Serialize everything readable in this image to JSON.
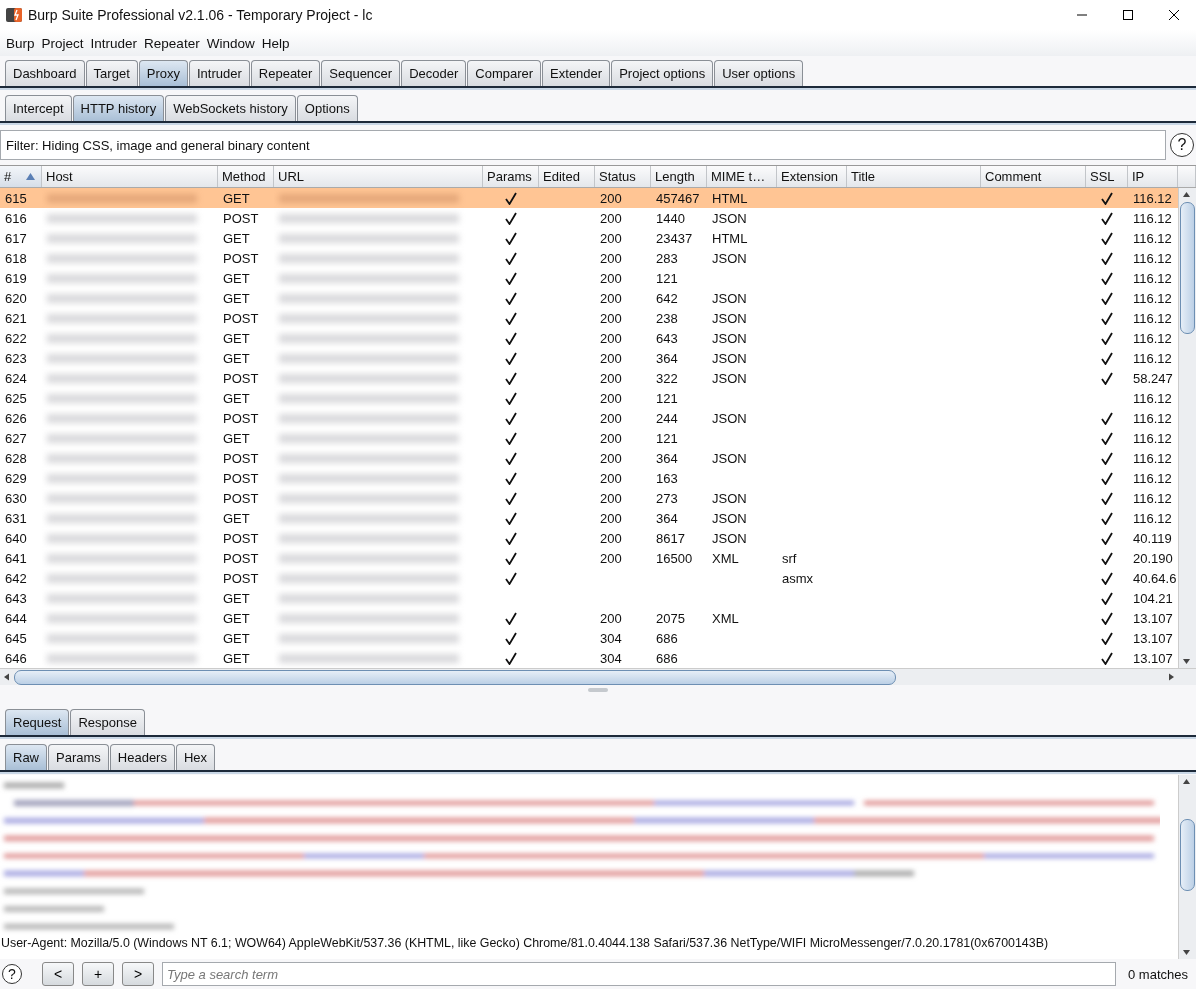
{
  "window": {
    "title": "Burp Suite Professional v2.1.06 - Temporary Project - lc"
  },
  "menu": [
    "Burp",
    "Project",
    "Intruder",
    "Repeater",
    "Window",
    "Help"
  ],
  "main_tabs": [
    {
      "label": "Dashboard",
      "selected": false
    },
    {
      "label": "Target",
      "selected": false
    },
    {
      "label": "Proxy",
      "selected": true
    },
    {
      "label": "Intruder",
      "selected": false
    },
    {
      "label": "Repeater",
      "selected": false
    },
    {
      "label": "Sequencer",
      "selected": false
    },
    {
      "label": "Decoder",
      "selected": false
    },
    {
      "label": "Comparer",
      "selected": false
    },
    {
      "label": "Extender",
      "selected": false
    },
    {
      "label": "Project options",
      "selected": false
    },
    {
      "label": "User options",
      "selected": false
    }
  ],
  "proxy_tabs": [
    {
      "label": "Intercept",
      "selected": false
    },
    {
      "label": "HTTP history",
      "selected": true
    },
    {
      "label": "WebSockets history",
      "selected": false
    },
    {
      "label": "Options",
      "selected": false
    }
  ],
  "filter": {
    "text": "Filter: Hiding CSS, image and general binary content",
    "help": "?"
  },
  "table": {
    "columns": [
      {
        "label": "#",
        "sorted": true
      },
      {
        "label": "Host",
        "sorted": false
      },
      {
        "label": "Method",
        "sorted": false
      },
      {
        "label": "URL",
        "sorted": false
      },
      {
        "label": "Params",
        "sorted": false
      },
      {
        "label": "Edited",
        "sorted": false
      },
      {
        "label": "Status",
        "sorted": false
      },
      {
        "label": "Length",
        "sorted": false
      },
      {
        "label": "MIME t…",
        "sorted": false
      },
      {
        "label": "Extension",
        "sorted": false
      },
      {
        "label": "Title",
        "sorted": false
      },
      {
        "label": "Comment",
        "sorted": false
      },
      {
        "label": "SSL",
        "sorted": false
      },
      {
        "label": "IP",
        "sorted": false
      }
    ],
    "rows": [
      {
        "number": "615",
        "method": "GET",
        "params": true,
        "status": "200",
        "length": "457467",
        "mime": "HTML",
        "ssl": true,
        "ip": "116.12",
        "selected": true
      },
      {
        "number": "616",
        "method": "POST",
        "params": true,
        "status": "200",
        "length": "1440",
        "mime": "JSON",
        "ssl": true,
        "ip": "116.12",
        "selected": false
      },
      {
        "number": "617",
        "method": "GET",
        "params": true,
        "status": "200",
        "length": "23437",
        "mime": "HTML",
        "ssl": true,
        "ip": "116.12",
        "selected": false
      },
      {
        "number": "618",
        "method": "POST",
        "params": true,
        "status": "200",
        "length": "283",
        "mime": "JSON",
        "ssl": true,
        "ip": "116.12",
        "selected": false
      },
      {
        "number": "619",
        "method": "GET",
        "params": true,
        "status": "200",
        "length": "121",
        "ssl": true,
        "ip": "116.12",
        "selected": false
      },
      {
        "number": "620",
        "method": "GET",
        "params": true,
        "status": "200",
        "length": "642",
        "mime": "JSON",
        "ssl": true,
        "ip": "116.12",
        "selected": false
      },
      {
        "number": "621",
        "method": "POST",
        "params": true,
        "status": "200",
        "length": "238",
        "mime": "JSON",
        "ssl": true,
        "ip": "116.12",
        "selected": false
      },
      {
        "number": "622",
        "method": "GET",
        "params": true,
        "status": "200",
        "length": "643",
        "mime": "JSON",
        "ssl": true,
        "ip": "116.12",
        "selected": false
      },
      {
        "number": "623",
        "method": "GET",
        "params": true,
        "status": "200",
        "length": "364",
        "mime": "JSON",
        "ssl": true,
        "ip": "116.12",
        "selected": false
      },
      {
        "number": "624",
        "method": "POST",
        "params": true,
        "status": "200",
        "length": "322",
        "mime": "JSON",
        "ssl": true,
        "ip": "58.247",
        "selected": false
      },
      {
        "number": "625",
        "method": "GET",
        "params": true,
        "status": "200",
        "length": "121",
        "ssl": false,
        "ip": "116.12",
        "selected": false
      },
      {
        "number": "626",
        "method": "POST",
        "params": true,
        "status": "200",
        "length": "244",
        "mime": "JSON",
        "ssl": true,
        "ip": "116.12",
        "selected": false
      },
      {
        "number": "627",
        "method": "GET",
        "params": true,
        "status": "200",
        "length": "121",
        "ssl": true,
        "ip": "116.12",
        "selected": false
      },
      {
        "number": "628",
        "method": "POST",
        "params": true,
        "status": "200",
        "length": "364",
        "mime": "JSON",
        "ssl": true,
        "ip": "116.12",
        "selected": false
      },
      {
        "number": "629",
        "method": "POST",
        "params": true,
        "status": "200",
        "length": "163",
        "ssl": true,
        "ip": "116.12",
        "selected": false
      },
      {
        "number": "630",
        "method": "POST",
        "params": true,
        "status": "200",
        "length": "273",
        "mime": "JSON",
        "ssl": true,
        "ip": "116.12",
        "selected": false
      },
      {
        "number": "631",
        "method": "GET",
        "params": true,
        "status": "200",
        "length": "364",
        "mime": "JSON",
        "ssl": true,
        "ip": "116.12",
        "selected": false
      },
      {
        "number": "640",
        "method": "POST",
        "params": true,
        "status": "200",
        "length": "8617",
        "mime": "JSON",
        "ssl": true,
        "ip": "40.119",
        "selected": false
      },
      {
        "number": "641",
        "method": "POST",
        "params": true,
        "status": "200",
        "length": "16500",
        "mime": "XML",
        "extension": "srf",
        "ssl": true,
        "ip": "20.190",
        "selected": false
      },
      {
        "number": "642",
        "method": "POST",
        "params": true,
        "extension": "asmx",
        "ssl": true,
        "ip": "40.64.6",
        "selected": false
      },
      {
        "number": "643",
        "method": "GET",
        "params": false,
        "ssl": true,
        "ip": "104.21",
        "selected": false
      },
      {
        "number": "644",
        "method": "GET",
        "params": true,
        "status": "200",
        "length": "2075",
        "mime": "XML",
        "ssl": true,
        "ip": "13.107",
        "selected": false
      },
      {
        "number": "645",
        "method": "GET",
        "params": true,
        "status": "304",
        "length": "686",
        "ssl": true,
        "ip": "13.107",
        "selected": false
      },
      {
        "number": "646",
        "method": "GET",
        "params": true,
        "status": "304",
        "length": "686",
        "ssl": true,
        "ip": "13.107",
        "selected": false
      }
    ]
  },
  "message_tabs": [
    {
      "label": "Request",
      "selected": true
    },
    {
      "label": "Response",
      "selected": false
    }
  ],
  "view_tabs": [
    {
      "label": "Raw",
      "selected": true
    },
    {
      "label": "Params",
      "selected": false
    },
    {
      "label": "Headers",
      "selected": false
    },
    {
      "label": "Hex",
      "selected": false
    }
  ],
  "request_text": "User-Agent: Mozilla/5.0 (Windows NT 6.1; WOW64) AppleWebKit/537.36 (KHTML, like Gecko) Chrome/81.0.4044.138 Safari/537.36 NetType/WIFI MicroMessenger/7.0.20.1781(0x6700143B)",
  "search": {
    "help": "?",
    "buttons": [
      "<",
      "+",
      ">"
    ],
    "placeholder": "Type a search term",
    "matches": "0 matches"
  }
}
